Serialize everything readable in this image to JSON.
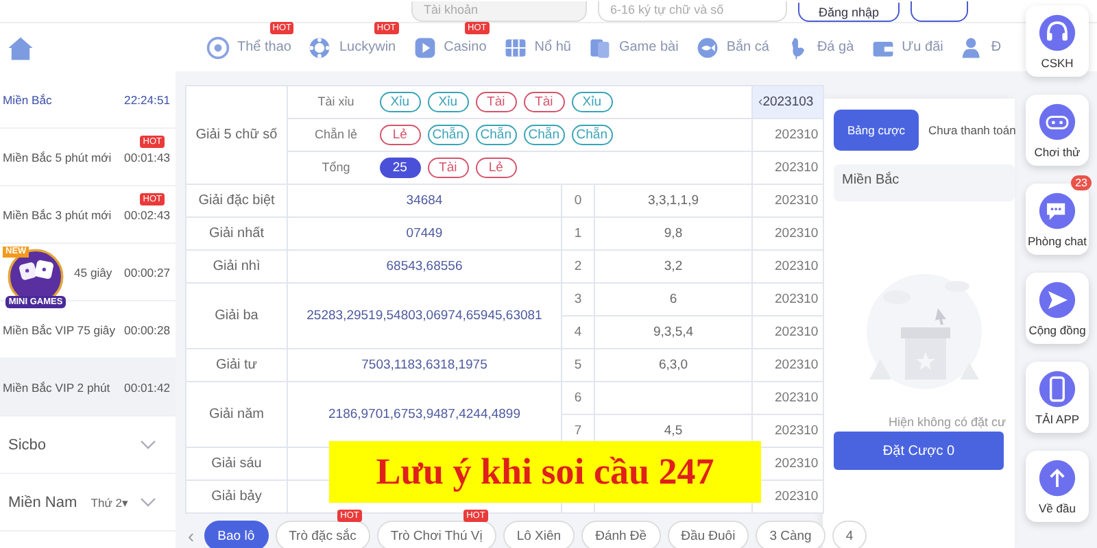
{
  "top_bar": {
    "account_field": {
      "placeholder": "Tài khoản"
    },
    "password_field": {
      "placeholder": "6-16 ký tự chữ và số"
    },
    "login_button": "Đăng nhập"
  },
  "nav": [
    {
      "kind": "ball",
      "label": "Thể thao",
      "badge": "HOT"
    },
    {
      "kind": "chip",
      "label": "Luckywin",
      "badge": "HOT"
    },
    {
      "kind": "play",
      "label": "Casino",
      "badge": "HOT"
    },
    {
      "kind": "grid",
      "label": "Nổ hũ"
    },
    {
      "kind": "cards",
      "label": "Game bài"
    },
    {
      "kind": "fish",
      "label": "Bắn cá"
    },
    {
      "kind": "rooster",
      "label": "Đá gà"
    },
    {
      "kind": "wallet",
      "label": "Ưu đãi"
    },
    {
      "kind": "person",
      "label": "Đ"
    }
  ],
  "sidebar": {
    "items": [
      {
        "name": "Miền Bắc",
        "time": "22:24:51",
        "selected": true,
        "hovered": false
      },
      {
        "name": "Miền Bắc 5 phút mới",
        "time": "00:01:43",
        "badge": "HOT",
        "selected": false,
        "hovered": false
      },
      {
        "name": "Miền Bắc 3 phút mới",
        "time": "00:02:43",
        "badge": "HOT",
        "selected": false,
        "hovered": false
      },
      {
        "name": "45 giây",
        "time": "00:00:27",
        "selected": false,
        "hovered": false
      },
      {
        "name": "Miền Bắc VIP 75 giây",
        "time": "00:00:28",
        "selected": false,
        "hovered": false
      },
      {
        "name": "Miền Bắc VIP 2 phút",
        "time": "00:01:42",
        "selected": false,
        "hovered": true
      }
    ],
    "groups": [
      {
        "name": "Sicbo",
        "expanded": false
      },
      {
        "name": "Miền Nam",
        "day": "Thứ 2▾",
        "expanded": false
      }
    ]
  },
  "minigames": {
    "badge": "NEW",
    "label": "MINI GAMES"
  },
  "results": {
    "five_digit": {
      "name": "Giải 5 chữ số",
      "lines": [
        {
          "label": "Tài xỉu",
          "pills": [
            {
              "text": "Xỉu",
              "color": "#3aa3b8",
              "filled": false
            },
            {
              "text": "Xỉu",
              "color": "#3aa3b8",
              "filled": false
            },
            {
              "text": "Tài",
              "color": "#d6546c",
              "filled": false
            },
            {
              "text": "Tài",
              "color": "#d6546c",
              "filled": false
            },
            {
              "text": "Xỉu",
              "color": "#3aa3b8",
              "filled": false
            }
          ]
        },
        {
          "label": "Chẵn lẻ",
          "pills": [
            {
              "text": "Lẻ",
              "color": "#d6546c",
              "filled": false
            },
            {
              "text": "Chẵn",
              "color": "#3aa3b8",
              "filled": false
            },
            {
              "text": "Chẵn",
              "color": "#3aa3b8",
              "filled": false
            },
            {
              "text": "Chẵn",
              "color": "#3aa3b8",
              "filled": false
            },
            {
              "text": "Chẵn",
              "color": "#3aa3b8",
              "filled": false
            }
          ]
        },
        {
          "label": "Tổng",
          "pills": [
            {
              "text": "25",
              "color": "#4b50d8",
              "filled": true
            },
            {
              "text": "Tài",
              "color": "#d6546c",
              "filled": false
            },
            {
              "text": "Lẻ",
              "color": "#d6546c",
              "filled": false
            }
          ]
        }
      ]
    },
    "prizes": [
      {
        "name": "Giải đặc biệt",
        "value": "34684",
        "rows": [
          {
            "index": "0",
            "digits": "3,3,1,1,9"
          }
        ]
      },
      {
        "name": "Giải nhất",
        "value": "07449",
        "rows": [
          {
            "index": "1",
            "digits": "9,8"
          }
        ]
      },
      {
        "name": "Giải nhì",
        "value": "68543,68556",
        "rows": [
          {
            "index": "2",
            "digits": "3,2"
          }
        ]
      },
      {
        "name": "Giải ba",
        "value": "25283,29519,54803,06974,65945,63081",
        "rows": [
          {
            "index": "3",
            "digits": "6"
          },
          {
            "index": "4",
            "digits": "9,3,5,4"
          }
        ]
      },
      {
        "name": "Giải tư",
        "value": "7503,1183,6318,1975",
        "rows": [
          {
            "index": "5",
            "digits": "6,3,0"
          }
        ]
      },
      {
        "name": "Giải năm",
        "value": "2186,9701,6753,9487,4244,4899",
        "rows": [
          {
            "index": "6"
          },
          {
            "index": "7",
            "digits": "4,5"
          }
        ]
      },
      {
        "name": "Giải sáu"
      },
      {
        "name": "Giải bảy"
      }
    ],
    "date_prev": "‹",
    "dates": [
      "2023103",
      "202310",
      "202310",
      "202310",
      "202310",
      "202310",
      "202310",
      "202310",
      "202310",
      "202310",
      "202310",
      "202310",
      "202310"
    ]
  },
  "bet_tabs_prev": "‹",
  "bet_tabs": [
    {
      "label": "Bao lô",
      "selected": true
    },
    {
      "label": "Trò đặc sắc",
      "badge": "HOT",
      "selected": false
    },
    {
      "label": "Trò Chơi Thú Vị",
      "badge": "HOT",
      "selected": false
    },
    {
      "label": "Lô Xiên",
      "selected": false
    },
    {
      "label": "Đánh Đề",
      "selected": false
    },
    {
      "label": "Đầu Đuôi",
      "selected": false
    },
    {
      "label": "3 Càng",
      "selected": false
    },
    {
      "label": "4",
      "selected": false
    }
  ],
  "bet_slip": {
    "tabs": [
      {
        "label": "Bảng cược",
        "selected": true
      },
      {
        "label": "Chưa thanh toán",
        "selected": false
      }
    ],
    "region": "Miền Bắc",
    "empty_text": "Hiện không có đặt cư",
    "submit": "Đặt Cược 0"
  },
  "side_buttons": [
    {
      "kind": "headset",
      "label": "CSKH"
    },
    {
      "kind": "gamepad",
      "label": "Chơi thử"
    },
    {
      "kind": "chat",
      "label": "Phòng chat",
      "badge": "23"
    },
    {
      "kind": "send",
      "label": "Cộng đồng"
    },
    {
      "kind": "phone",
      "label": "TẢI APP"
    },
    {
      "kind": "up",
      "label": "Về đầu"
    }
  ],
  "caption": "Lưu ý khi soi cầu 247"
}
